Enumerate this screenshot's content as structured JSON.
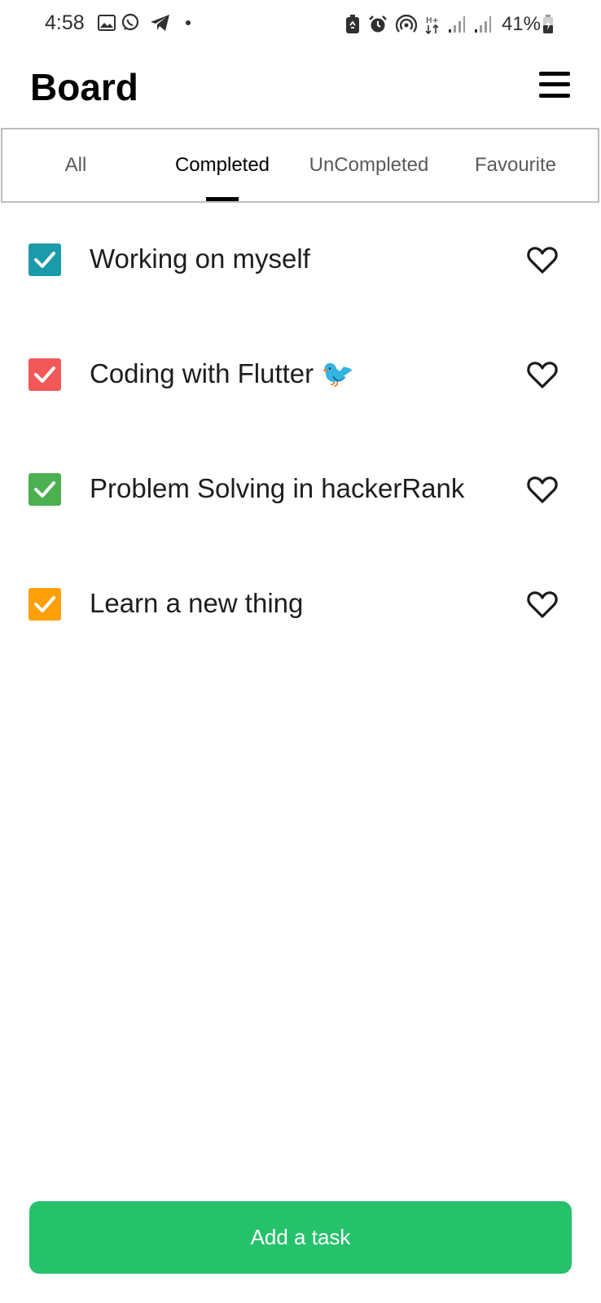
{
  "status_bar": {
    "time": "4:58",
    "battery": "41%",
    "left_icons": [
      "gallery-icon",
      "whatsapp-icon",
      "telegram-icon",
      "dot-icon"
    ],
    "right_icons": [
      "battery-saver-icon",
      "alarm-icon",
      "hotspot-icon",
      "data-transfer-icon",
      "signal-icon",
      "signal-icon",
      "battery-icon"
    ]
  },
  "header": {
    "title": "Board",
    "menu_icon": "hamburger-menu-icon"
  },
  "tabs": {
    "items": [
      {
        "label": "All"
      },
      {
        "label": "Completed"
      },
      {
        "label": "UnCompleted"
      },
      {
        "label": "Favourite"
      }
    ],
    "active": "Completed"
  },
  "tasks": [
    {
      "title": "Working on myself",
      "color": "#1b9aaa",
      "checked": true,
      "favourite": false
    },
    {
      "title": "Coding with Flutter 🐦",
      "color": "#f25858",
      "checked": true,
      "favourite": false
    },
    {
      "title": "Problem Solving in hackerRank",
      "color": "#4caf50",
      "checked": true,
      "favourite": false
    },
    {
      "title": "Learn a new thing",
      "color": "#ff9f0a",
      "checked": true,
      "favourite": false
    }
  ],
  "add_button": {
    "label": "Add a task",
    "color": "#25c26b"
  }
}
